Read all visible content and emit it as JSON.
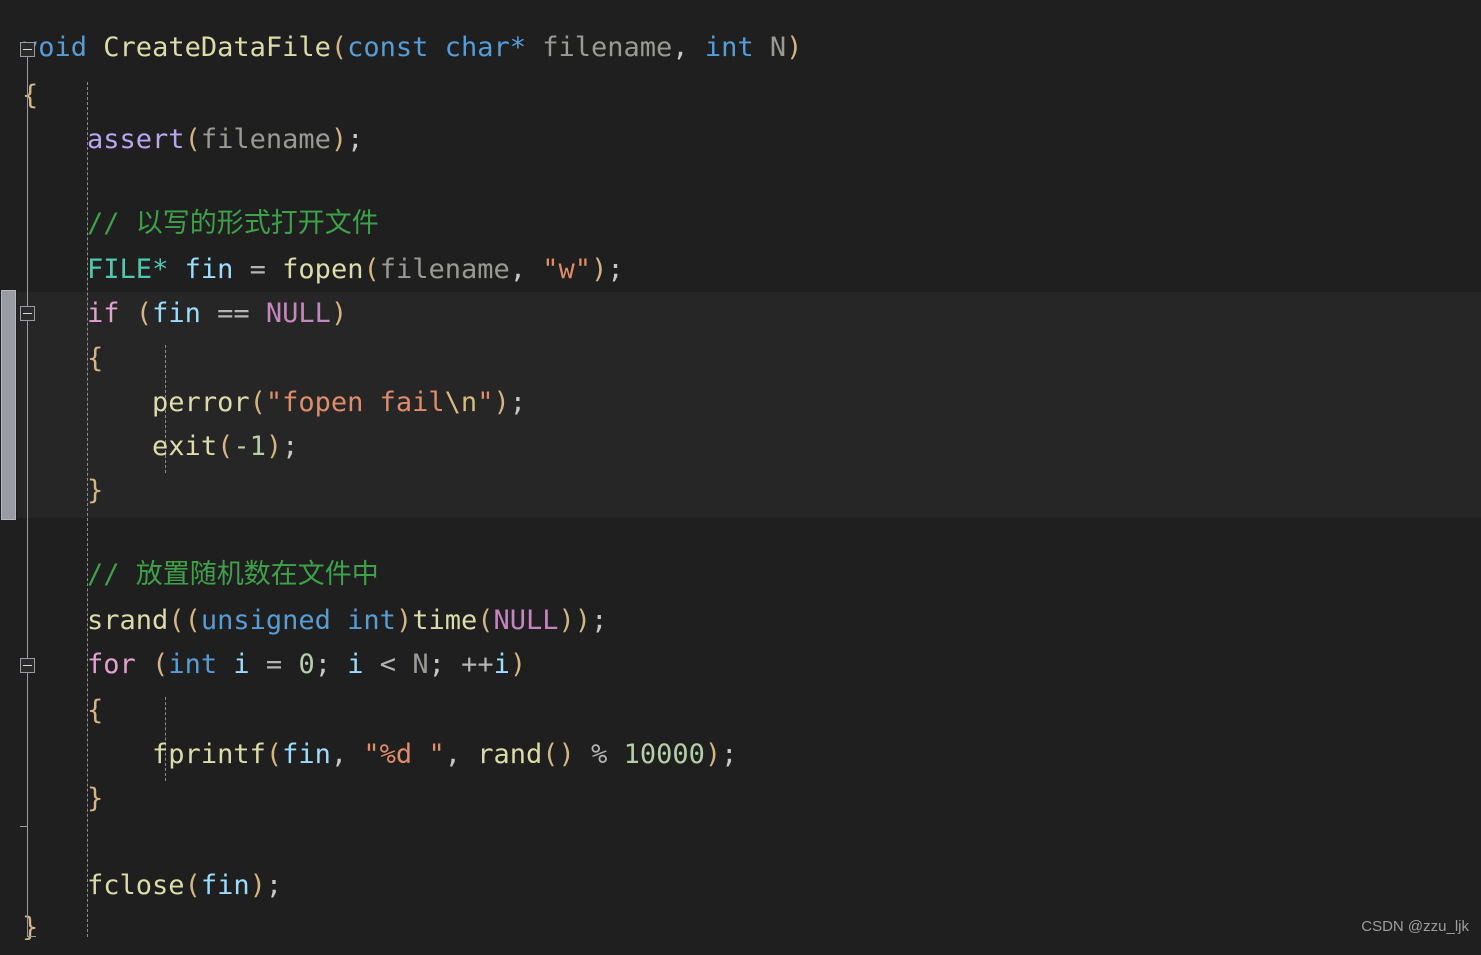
{
  "editor": {
    "language": "c",
    "theme": "dark",
    "background_color": "#1f1f1f",
    "highlight_band_color": "#262626",
    "watermark": "CSDN @zzu_ljk"
  },
  "colors": {
    "keyword": "#569cd6",
    "control": "#e4a0d0",
    "function": "#dcdcaa",
    "type": "#4ec9b0",
    "variable": "#9cdcfe",
    "parameter": "#9a9a94",
    "macro": "#c586c0",
    "assert_macro": "#b9a5f0",
    "string": "#e08b69",
    "escape": "#d7ba7d",
    "number": "#b5cea8",
    "comment": "#3fa04a",
    "punctuation": "#c8c8c8",
    "brace": "#d4b483"
  },
  "code": {
    "lines": [
      "void CreateDataFile(const char* filename, int N)",
      "{",
      "    assert(filename);",
      "",
      "    // 以写的形式打开文件",
      "    FILE* fin = fopen(filename, \"w\");",
      "    if (fin == NULL)",
      "    {",
      "        perror(\"fopen fail\\n\");",
      "        exit(-1);",
      "    }",
      "",
      "    // 放置随机数在文件中",
      "    srand((unsigned int)time(NULL));",
      "    for (int i = 0; i < N; ++i)",
      "    {",
      "        fprintf(fin, \"%d \", rand() % 10000);",
      "    }",
      "",
      "    fclose(fin);",
      "}"
    ]
  },
  "tokens": {
    "line1": {
      "void": "void",
      "space1": " ",
      "fnname": "CreateDataFile",
      "lparen": "(",
      "const": "const",
      "space2": " ",
      "char": "char",
      "star": "*",
      "space3": " ",
      "filename": "filename",
      "comma": ",",
      "space4": " ",
      "int": "int",
      "space5": " ",
      "N": "N",
      "rparen": ")"
    },
    "line2": {
      "brace": "{"
    },
    "line3": {
      "indent": "    ",
      "assert": "assert",
      "lparen": "(",
      "filename": "filename",
      "rparen": ")",
      "semi": ";"
    },
    "line5": {
      "indent": "    ",
      "comment": "// 以写的形式打开文件"
    },
    "line6": {
      "indent": "    ",
      "FILE": "FILE",
      "star": "*",
      "space1": " ",
      "fin": "fin",
      "space2": " ",
      "eq": "=",
      "space3": " ",
      "fopen": "fopen",
      "lparen": "(",
      "filename": "filename",
      "comma": ",",
      "space4": " ",
      "str": "\"w\"",
      "rparen": ")",
      "semi": ";"
    },
    "line7": {
      "indent": "    ",
      "if": "if",
      "space1": " ",
      "lparen": "(",
      "fin": "fin",
      "space2": " ",
      "eqeq": "==",
      "space3": " ",
      "NULL": "NULL",
      "rparen": ")"
    },
    "line8": {
      "indent": "    ",
      "brace": "{"
    },
    "line9": {
      "indent": "        ",
      "perror": "perror",
      "lparen": "(",
      "str1": "\"fopen fail",
      "esc": "\\n",
      "str2": "\"",
      "rparen": ")",
      "semi": ";"
    },
    "line10": {
      "indent": "        ",
      "exit": "exit",
      "lparen": "(",
      "num": "-1",
      "rparen": ")",
      "semi": ";"
    },
    "line11": {
      "indent": "    ",
      "brace": "}"
    },
    "line13": {
      "indent": "    ",
      "comment": "// 放置随机数在文件中"
    },
    "line14": {
      "indent": "    ",
      "srand": "srand",
      "lparen1": "(",
      "lparen2": "(",
      "unsigned": "unsigned",
      "space1": " ",
      "int": "int",
      "rparen1": ")",
      "time": "time",
      "lparen3": "(",
      "NULL": "NULL",
      "rparen2": ")",
      "rparen3": ")",
      "semi": ";"
    },
    "line15": {
      "indent": "    ",
      "for": "for",
      "space1": " ",
      "lparen": "(",
      "int": "int",
      "space2": " ",
      "i1": "i",
      "space3": " ",
      "eq": "=",
      "space4": " ",
      "zero": "0",
      "semi1": ";",
      "space5": " ",
      "i2": "i",
      "space6": " ",
      "lt": "<",
      "space7": " ",
      "N": "N",
      "semi2": ";",
      "space8": " ",
      "incr": "++",
      "i3": "i",
      "rparen": ")"
    },
    "line16": {
      "indent": "    ",
      "brace": "{"
    },
    "line17": {
      "indent": "        ",
      "fprintf": "fprintf",
      "lparen": "(",
      "fin": "fin",
      "comma1": ",",
      "space1": " ",
      "str": "\"%d \"",
      "comma2": ",",
      "space2": " ",
      "rand": "rand",
      "lparen2": "(",
      "rparen2": ")",
      "space3": " ",
      "mod": "%",
      "space4": " ",
      "num": "10000",
      "rparen": ")",
      "semi": ";"
    },
    "line18": {
      "indent": "    ",
      "brace": "}"
    },
    "line20": {
      "indent": "    ",
      "fclose": "fclose",
      "lparen": "(",
      "fin": "fin",
      "rparen": ")",
      "semi": ";"
    },
    "line21": {
      "brace": "}"
    }
  },
  "gutter": {
    "fold_markers": [
      {
        "label": "collapse-function",
        "state": "expanded"
      },
      {
        "label": "collapse-if-block",
        "state": "expanded"
      },
      {
        "label": "collapse-for-block",
        "state": "expanded"
      }
    ]
  },
  "scrollbars": {
    "vertical": {
      "orientation": "vertical",
      "position": "left"
    },
    "horizontal": {
      "orientation": "horizontal",
      "position": "bottom"
    }
  }
}
